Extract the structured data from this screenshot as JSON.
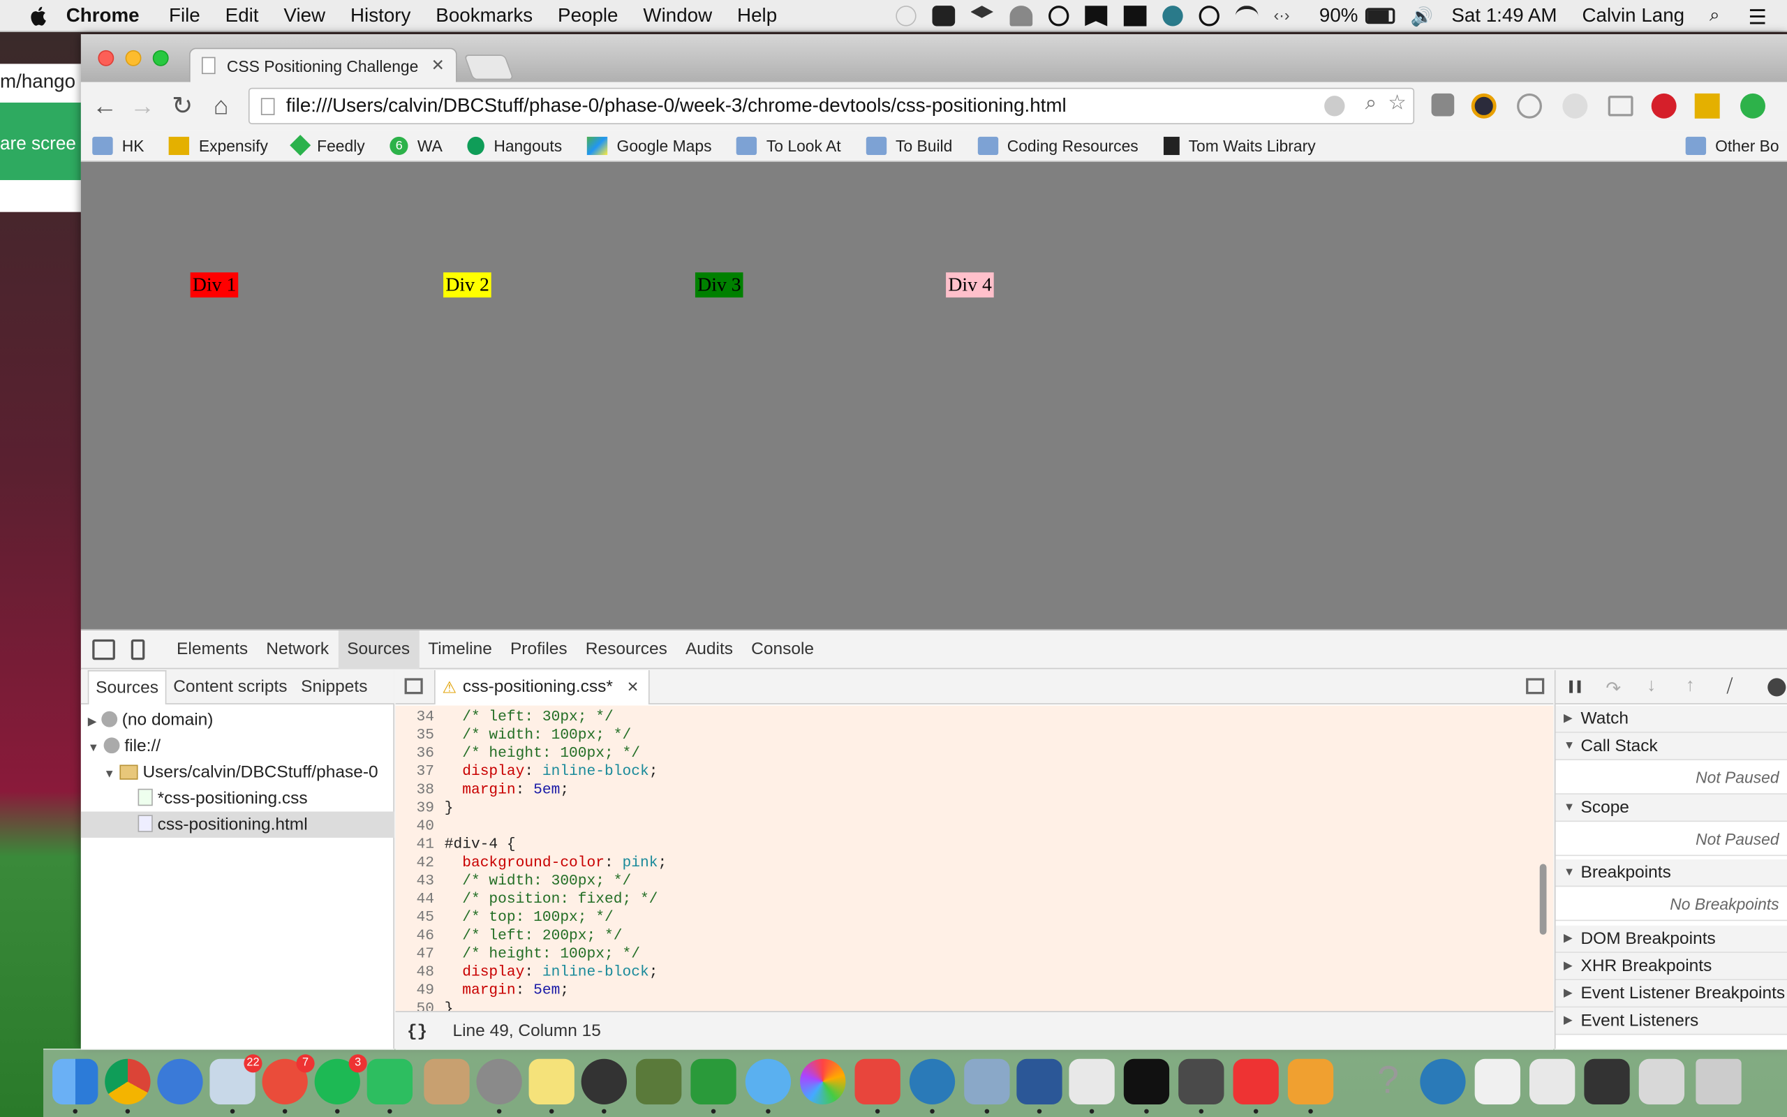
{
  "menubar": {
    "app": "Chrome",
    "items": [
      "File",
      "Edit",
      "View",
      "History",
      "Bookmarks",
      "People",
      "Window",
      "Help"
    ],
    "battery": "90%",
    "clock": "Sat 1:49 AM",
    "user": "Calvin Lang"
  },
  "background_window": {
    "url_fragment": "m/hango",
    "green_text": "are scree"
  },
  "browser": {
    "tab_title": "CSS Positioning Challenge",
    "url": "file:///Users/calvin/DBCStuff/phase-0/phase-0/week-3/chrome-devtools/css-positioning.html",
    "bookmarks": [
      "HK",
      "Expensify",
      "Feedly",
      "WA",
      "Hangouts",
      "Google Maps",
      "To Look At",
      "To Build",
      "Coding Resources",
      "Tom Waits Library"
    ],
    "other_bookmarks": "Other Bo",
    "wa_count": "6"
  },
  "page": {
    "divs": [
      {
        "label": "Div 1",
        "color": "#ff0000"
      },
      {
        "label": "Div 2",
        "color": "#ffff00"
      },
      {
        "label": "Div 3",
        "color": "#008000"
      },
      {
        "label": "Div 4",
        "color": "#ffc0cb"
      }
    ]
  },
  "devtools": {
    "tabs": [
      "Elements",
      "Network",
      "Sources",
      "Timeline",
      "Profiles",
      "Resources",
      "Audits",
      "Console"
    ],
    "active_tab": "Sources",
    "navigator_tabs": [
      "Sources",
      "Content scripts",
      "Snippets"
    ],
    "tree": [
      "(no domain)",
      "file://",
      "Users/calvin/DBCStuff/phase-0",
      "*css-positioning.css",
      "css-positioning.html"
    ],
    "editor_tab": "css-positioning.css*",
    "status": "Line 49, Column 15",
    "code": [
      {
        "n": "34",
        "t": "  /* left: 30px; */"
      },
      {
        "n": "35",
        "t": "  /* width: 100px; */"
      },
      {
        "n": "36",
        "t": "  /* height: 100px; */"
      },
      {
        "n": "37",
        "t": "  display: inline-block;"
      },
      {
        "n": "38",
        "t": "  margin: 5em;"
      },
      {
        "n": "39",
        "t": "}"
      },
      {
        "n": "40",
        "t": ""
      },
      {
        "n": "41",
        "t": "#div-4 {"
      },
      {
        "n": "42",
        "t": "  background-color: pink;"
      },
      {
        "n": "43",
        "t": "  /* width: 300px; */"
      },
      {
        "n": "44",
        "t": "  /* position: fixed; */"
      },
      {
        "n": "45",
        "t": "  /* top: 100px; */"
      },
      {
        "n": "46",
        "t": "  /* left: 200px; */"
      },
      {
        "n": "47",
        "t": "  /* height: 100px; */"
      },
      {
        "n": "48",
        "t": "  display: inline-block;"
      },
      {
        "n": "49",
        "t": "  margin: 5em;"
      },
      {
        "n": "50",
        "t": "}"
      }
    ],
    "sidebar": {
      "watch": "Watch",
      "call_stack": "Call Stack",
      "call_stack_body": "Not Paused",
      "scope": "Scope",
      "scope_body": "Not Paused",
      "breakpoints": "Breakpoints",
      "breakpoints_body": "No Breakpoints",
      "dom_breakpoints": "DOM Breakpoints",
      "xhr_breakpoints": "XHR Breakpoints",
      "event_listener_breakpoints": "Event Listener Breakpoints",
      "event_listeners": "Event Listeners"
    }
  },
  "dock": {
    "badges": {
      "mail": "22",
      "wunderlist": "7",
      "spotify": "3"
    }
  }
}
